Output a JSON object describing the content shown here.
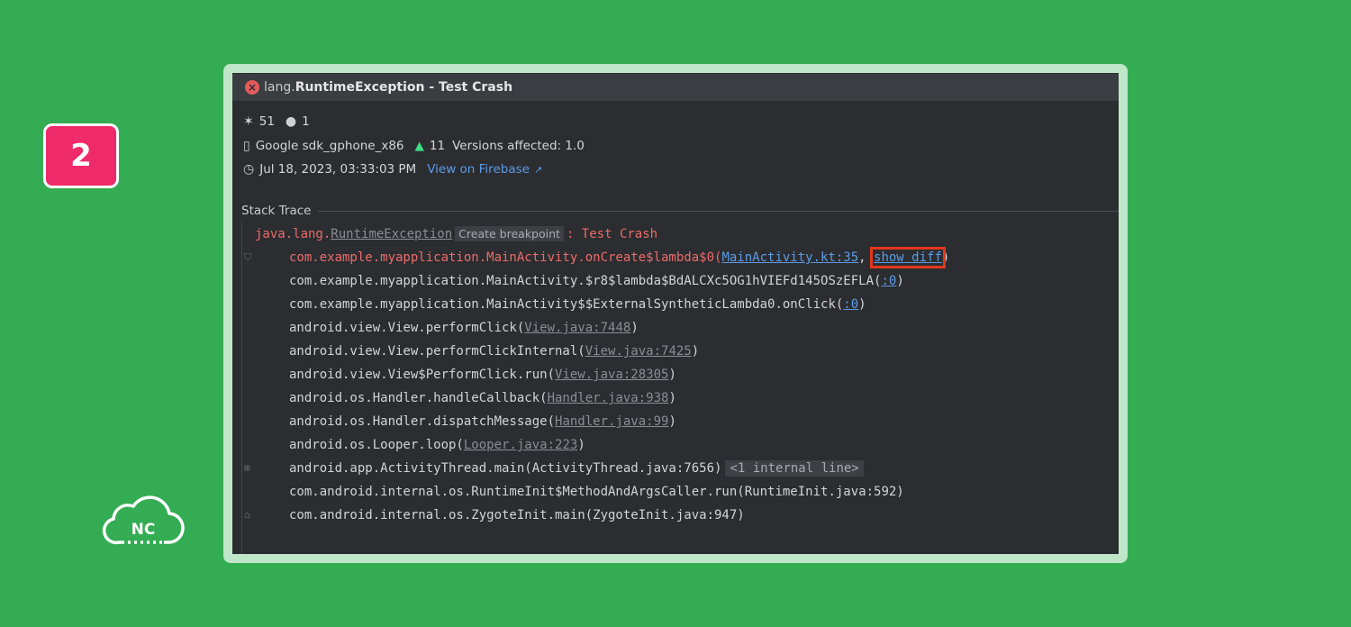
{
  "step_number": "2",
  "logo_text": "NC",
  "window": {
    "title_prefix": "lang.",
    "title_main": "RuntimeException - Test Crash"
  },
  "stats": {
    "events_count": "51",
    "users_count": "1"
  },
  "device": {
    "name": "Google sdk_gphone_x86",
    "api_level": "11",
    "versions_affected": "Versions affected: 1.0"
  },
  "timestamp": "Jul 18, 2023, 03:33:03 PM",
  "firebase_link": "View on Firebase",
  "firebase_link_icon": "↗",
  "section_title": "Stack Trace",
  "exception": {
    "prefix": "java.lang.",
    "class_name": "RuntimeException",
    "breakpoint_label": "Create breakpoint",
    "message": ": Test Crash"
  },
  "frames": [
    {
      "text": "com.example.myapplication.MainActivity.onCreate$lambda$0(",
      "link": "MainActivity.kt:35",
      "extra": "show diff",
      "suffix": ")",
      "style": "red",
      "link_style": "blue",
      "gutter": "⛉"
    },
    {
      "text": "com.example.myapplication.MainActivity.$r8$lambda$BdALCXc5OG1hVIEFd145OSzEFLA(",
      "link": ":0",
      "suffix": ")",
      "style": "plain",
      "link_style": "blue"
    },
    {
      "text": "com.example.myapplication.MainActivity$$ExternalSyntheticLambda0.onClick(",
      "link": ":0",
      "suffix": ")",
      "style": "plain",
      "link_style": "blue"
    },
    {
      "text": "android.view.View.performClick(",
      "link": "View.java:7448",
      "suffix": ")",
      "style": "plain",
      "link_style": "gray"
    },
    {
      "text": "android.view.View.performClickInternal(",
      "link": "View.java:7425",
      "suffix": ")",
      "style": "plain",
      "link_style": "gray"
    },
    {
      "text": "android.view.View$PerformClick.run(",
      "link": "View.java:28305",
      "suffix": ")",
      "style": "plain",
      "link_style": "gray"
    },
    {
      "text": "android.os.Handler.handleCallback(",
      "link": "Handler.java:938",
      "suffix": ")",
      "style": "plain",
      "link_style": "gray"
    },
    {
      "text": "android.os.Handler.dispatchMessage(",
      "link": "Handler.java:99",
      "suffix": ")",
      "style": "plain",
      "link_style": "gray"
    },
    {
      "text": "android.os.Looper.loop(",
      "link": "Looper.java:223",
      "suffix": ")",
      "style": "plain",
      "link_style": "gray"
    },
    {
      "text": "android.app.ActivityThread.main(ActivityThread.java:7656)",
      "chip": "<1 internal line>",
      "style": "plain",
      "gutter": "⊞"
    },
    {
      "text": "com.android.internal.os.RuntimeInit$MethodAndArgsCaller.run(RuntimeInit.java:592)",
      "style": "plain"
    },
    {
      "text": "com.android.internal.os.ZygoteInit.main(ZygoteInit.java:947)",
      "style": "plain",
      "gutter": "⌂"
    }
  ],
  "colors": {
    "background": "#34ac54",
    "badge": "#ef2a6b",
    "panel": "#2b2d30",
    "error_red": "#ec6b6b",
    "link_blue": "#5c9ce6",
    "highlight_box": "#e2371c"
  }
}
